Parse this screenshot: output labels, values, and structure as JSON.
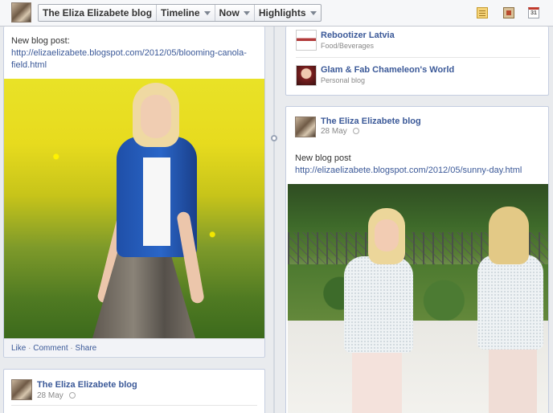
{
  "topbar": {
    "crumbs": [
      {
        "label": "The Eliza Elizabete blog",
        "caret": false
      },
      {
        "label": "Timeline",
        "caret": true
      },
      {
        "label": "Now",
        "caret": true
      },
      {
        "label": "Highlights",
        "caret": true
      }
    ],
    "icons": [
      "notes-icon",
      "photo-icon",
      "calendar-icon"
    ],
    "calendar_text": "31"
  },
  "left_posts": [
    {
      "text_prefix": "New blog post:",
      "link": "http://elizaelizabete.blogspot.com/2012/05/blooming-canola-field.html",
      "actions": [
        "Like",
        "Comment",
        "Share"
      ]
    },
    {
      "author": "The Eliza Elizabete blog",
      "date": "28 May"
    }
  ],
  "right_list": [
    {
      "title": "Rebootizer Latvia",
      "subtitle": "Food/Beverages"
    },
    {
      "title": "Glam & Fab Chameleon's World",
      "subtitle": "Personal blog"
    }
  ],
  "right_post": {
    "author": "The Eliza Elizabete blog",
    "date": "28 May",
    "text_prefix": "New blog post",
    "link": "http://elizaelizabete.blogspot.com/2012/05/sunny-day.html"
  },
  "colors": {
    "link": "#3b5998",
    "background": "#e9ebee",
    "card_border": "#c4cde0"
  }
}
